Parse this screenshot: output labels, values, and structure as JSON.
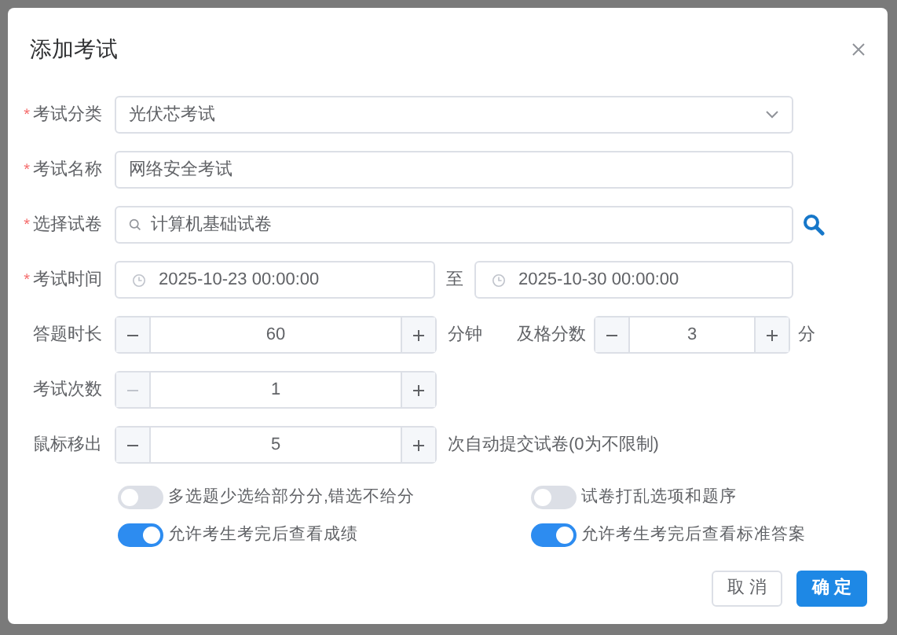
{
  "dialog": {
    "title": "添加考试"
  },
  "fields": [
    {
      "kind": "select",
      "label": "考试分类",
      "required_mark": "*",
      "value": "光伏芯考试"
    },
    {
      "kind": "text",
      "label": "考试名称",
      "required_mark": "*",
      "value": "网络安全考试"
    },
    {
      "kind": "paper",
      "label": "选择试卷",
      "required_mark": "*",
      "value": "计算机基础试卷"
    },
    {
      "kind": "daterange",
      "label": "考试时间",
      "required_mark": "*",
      "start": "2025-10-23 00:00:00",
      "separator": "至",
      "end": "2025-10-30 00:00:00"
    }
  ],
  "steppers": [
    {
      "label": "答题时长",
      "value": "60",
      "minus_disabled": false,
      "unit": "分钟",
      "second": {
        "label": "及格分数",
        "value": "3",
        "minus_disabled": false,
        "unit": "分"
      }
    },
    {
      "label": "考试次数",
      "value": "1",
      "minus_disabled": true
    },
    {
      "label": "鼠标移出",
      "value": "5",
      "minus_disabled": false,
      "unit": "次自动提交试卷(0为不限制)"
    }
  ],
  "switches": [
    {
      "label": "多选题少选给部分分,错选不给分",
      "on": false
    },
    {
      "label": "试卷打乱选项和题序",
      "on": false
    },
    {
      "label": "允许考生考完后查看成绩",
      "on": true
    },
    {
      "label": "允许考生考完后查看标准答案",
      "on": true
    }
  ],
  "buttons": [
    {
      "label": "取 消",
      "kind": "default"
    },
    {
      "label": "确 定",
      "kind": "primary"
    }
  ]
}
